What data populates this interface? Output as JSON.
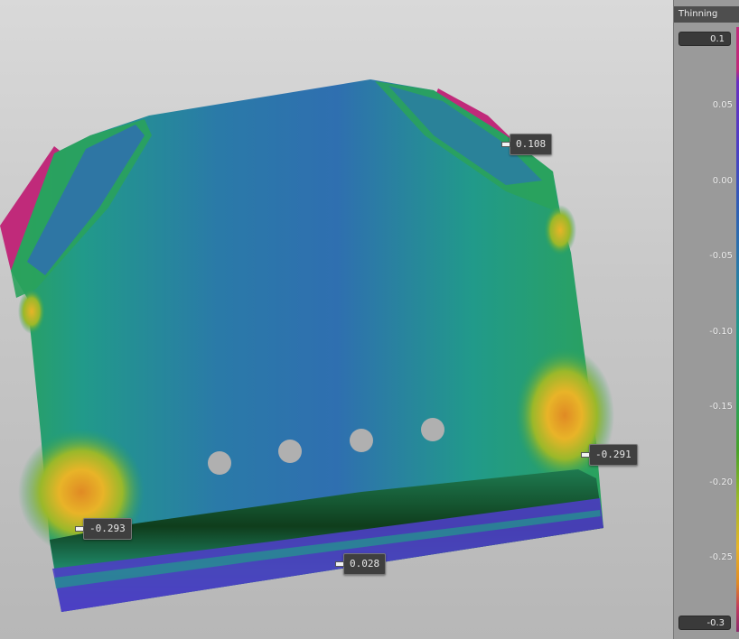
{
  "legend": {
    "title": "Thinning",
    "max_value": "0.1",
    "min_value": "-0.3",
    "ticks": [
      "0.05",
      "0.00",
      "-0.05",
      "-0.10",
      "-0.15",
      "-0.20",
      "-0.25"
    ]
  },
  "callouts": [
    "0.108",
    "-0.291",
    "-0.293",
    "0.028"
  ],
  "colors": {
    "magenta": "#c02a7a",
    "purple": "#5a3ac4",
    "blue": "#2f5fb4",
    "teal": "#219a8a",
    "green": "#2aa25c",
    "yellow": "#e8b428",
    "orange": "#e08a24"
  }
}
